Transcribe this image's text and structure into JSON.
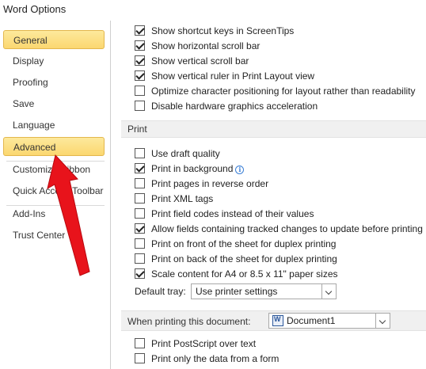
{
  "window": {
    "title": "Word Options"
  },
  "sidebar": {
    "items": [
      {
        "label": "General",
        "selected": true
      },
      {
        "label": "Display"
      },
      {
        "label": "Proofing"
      },
      {
        "label": "Save"
      },
      {
        "label": "Language"
      },
      {
        "label": "Advanced",
        "selected": true
      },
      {
        "label": "Customize Ribbon"
      },
      {
        "label": "Quick Access Toolbar"
      },
      {
        "label": "Add-Ins"
      },
      {
        "label": "Trust Center"
      }
    ]
  },
  "display_options": [
    {
      "label": "Show shortcut keys in ScreenTips",
      "checked": true
    },
    {
      "label": "Show horizontal scroll bar",
      "checked": true
    },
    {
      "label": "Show vertical scroll bar",
      "checked": true
    },
    {
      "label": "Show vertical ruler in Print Layout view",
      "checked": true
    },
    {
      "label": "Optimize character positioning for layout rather than readability",
      "checked": false
    },
    {
      "label": "Disable hardware graphics acceleration",
      "checked": false
    }
  ],
  "print": {
    "header": "Print",
    "options": [
      {
        "label": "Use draft quality",
        "checked": false
      },
      {
        "label": "Print in background",
        "checked": true
      },
      {
        "label": "Print pages in reverse order",
        "checked": false
      },
      {
        "label": "Print XML tags",
        "checked": false
      },
      {
        "label": "Print field codes instead of their values",
        "checked": false
      },
      {
        "label": "Allow fields containing tracked changes to update before printing",
        "checked": true
      },
      {
        "label": "Print on front of the sheet for duplex printing",
        "checked": false
      },
      {
        "label": "Print on back of the sheet for duplex printing",
        "checked": false
      },
      {
        "label": "Scale content for A4 or 8.5 x 11\" paper sizes",
        "checked": true
      }
    ],
    "default_tray_label": "Default tray:",
    "default_tray_value": "Use printer settings"
  },
  "when_printing": {
    "header": "When printing this document:",
    "document": "Document1",
    "options": [
      {
        "label": "Print PostScript over text",
        "checked": false
      },
      {
        "label": "Print only the data from a form",
        "checked": false
      }
    ]
  },
  "colors": {
    "selected_bg": "#fbd770",
    "arrow": "#e8131b",
    "info": "#3b7fd6"
  },
  "icons": {
    "info": "info-icon",
    "document": "word-document-icon",
    "dropdown": "chevron-down-icon",
    "annotation": "red-arrow"
  }
}
